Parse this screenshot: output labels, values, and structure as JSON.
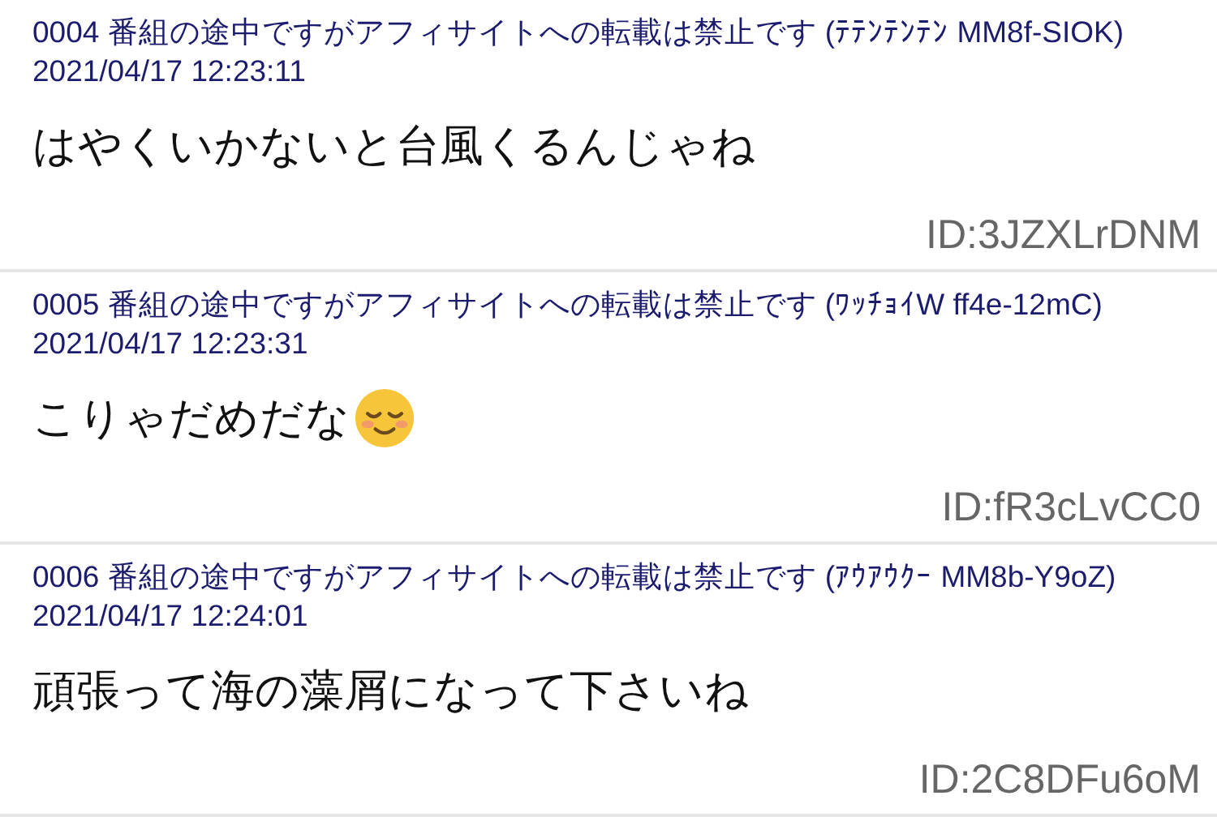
{
  "posts": [
    {
      "header": "0004 番組の途中ですがアフィサイトへの転載は禁止です (ﾃﾃﾝﾃﾝﾃﾝ MM8f-SIOK) 2021/04/17 12:23:11",
      "body": "はやくいかないと台風くるんじゃね",
      "emoji": false,
      "id": "ID:3JZXLrDNM"
    },
    {
      "header": "0005 番組の途中ですがアフィサイトへの転載は禁止です (ﾜｯﾁｮｲW ff4e-12mC) 2021/04/17 12:23:31",
      "body": "こりゃだめだな",
      "emoji": true,
      "id": "ID:fR3cLvCC0"
    },
    {
      "header": "0006 番組の途中ですがアフィサイトへの転載は禁止です (ｱｳｱｳｸｰ MM8b-Y9oZ) 2021/04/17 12:24:01",
      "body": "頑張って海の藻屑になって下さいね",
      "emoji": false,
      "id": "ID:2C8DFu6oM"
    }
  ]
}
